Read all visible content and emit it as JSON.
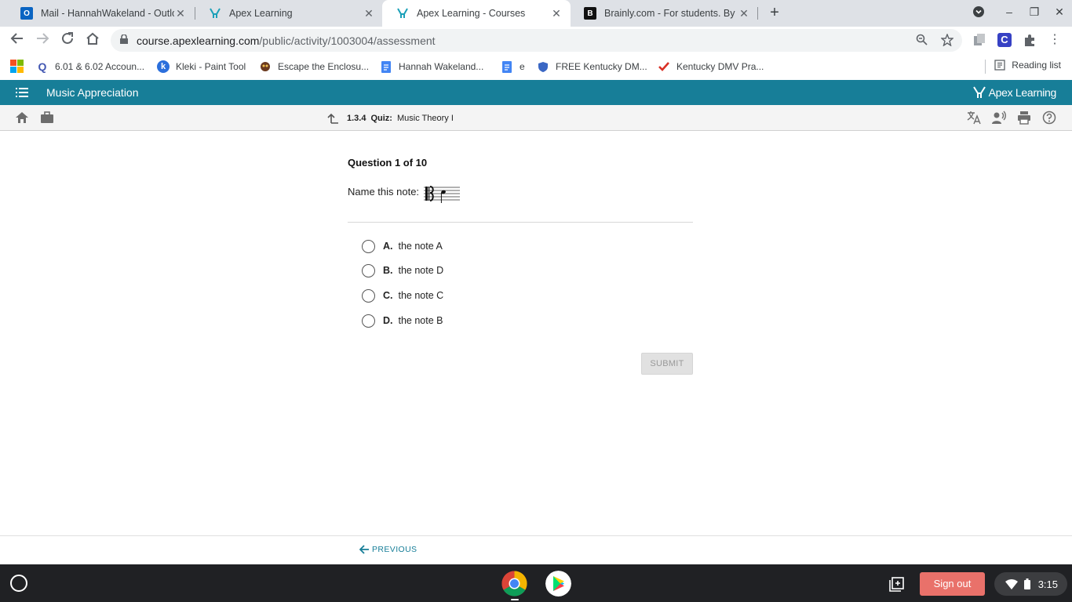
{
  "browser": {
    "tabs": [
      {
        "title": "Mail - HannahWakeland - Outlook",
        "icon": "outlook-icon",
        "active": false
      },
      {
        "title": "Apex Learning",
        "icon": "apex-icon",
        "active": false
      },
      {
        "title": "Apex Learning - Courses",
        "icon": "apex-icon",
        "active": true
      },
      {
        "title": "Brainly.com - For students. By students.",
        "icon": "brainly-icon",
        "active": false
      }
    ],
    "url_domain": "course.apexlearning.com",
    "url_path": "/public/activity/1003004/assessment",
    "bookmarks": [
      {
        "label": "6.01 & 6.02 Accoun...",
        "icon": "quizlet-icon"
      },
      {
        "label": "Kleki - Paint Tool",
        "icon": "kleki-icon"
      },
      {
        "label": "Escape the Enclosu...",
        "icon": "game-icon"
      },
      {
        "label": "Hannah Wakeland...",
        "icon": "docs-icon"
      },
      {
        "label": "e",
        "icon": "docs-icon"
      },
      {
        "label": "FREE Kentucky DM...",
        "icon": "shield-icon"
      },
      {
        "label": "Kentucky DMV Pra...",
        "icon": "check-icon"
      }
    ],
    "reading_list": "Reading list"
  },
  "app": {
    "course_title": "Music Appreciation",
    "brand": "Apex Learning",
    "breadcrumb": {
      "number": "1.3.4",
      "type": "Quiz:",
      "title": "Music Theory I"
    }
  },
  "question": {
    "counter": "Question 1 of 10",
    "prompt": "Name this note:",
    "options": [
      {
        "letter": "A.",
        "text": "the note A"
      },
      {
        "letter": "B.",
        "text": "the note D"
      },
      {
        "letter": "C.",
        "text": "the note C"
      },
      {
        "letter": "D.",
        "text": "the note B"
      }
    ],
    "submit_label": "SUBMIT"
  },
  "footer": {
    "previous_label": "PREVIOUS"
  },
  "shelf": {
    "sign_out": "Sign out",
    "time": "3:15"
  },
  "colors": {
    "brand_teal": "#177e98",
    "sign_out": "#e9716a"
  }
}
